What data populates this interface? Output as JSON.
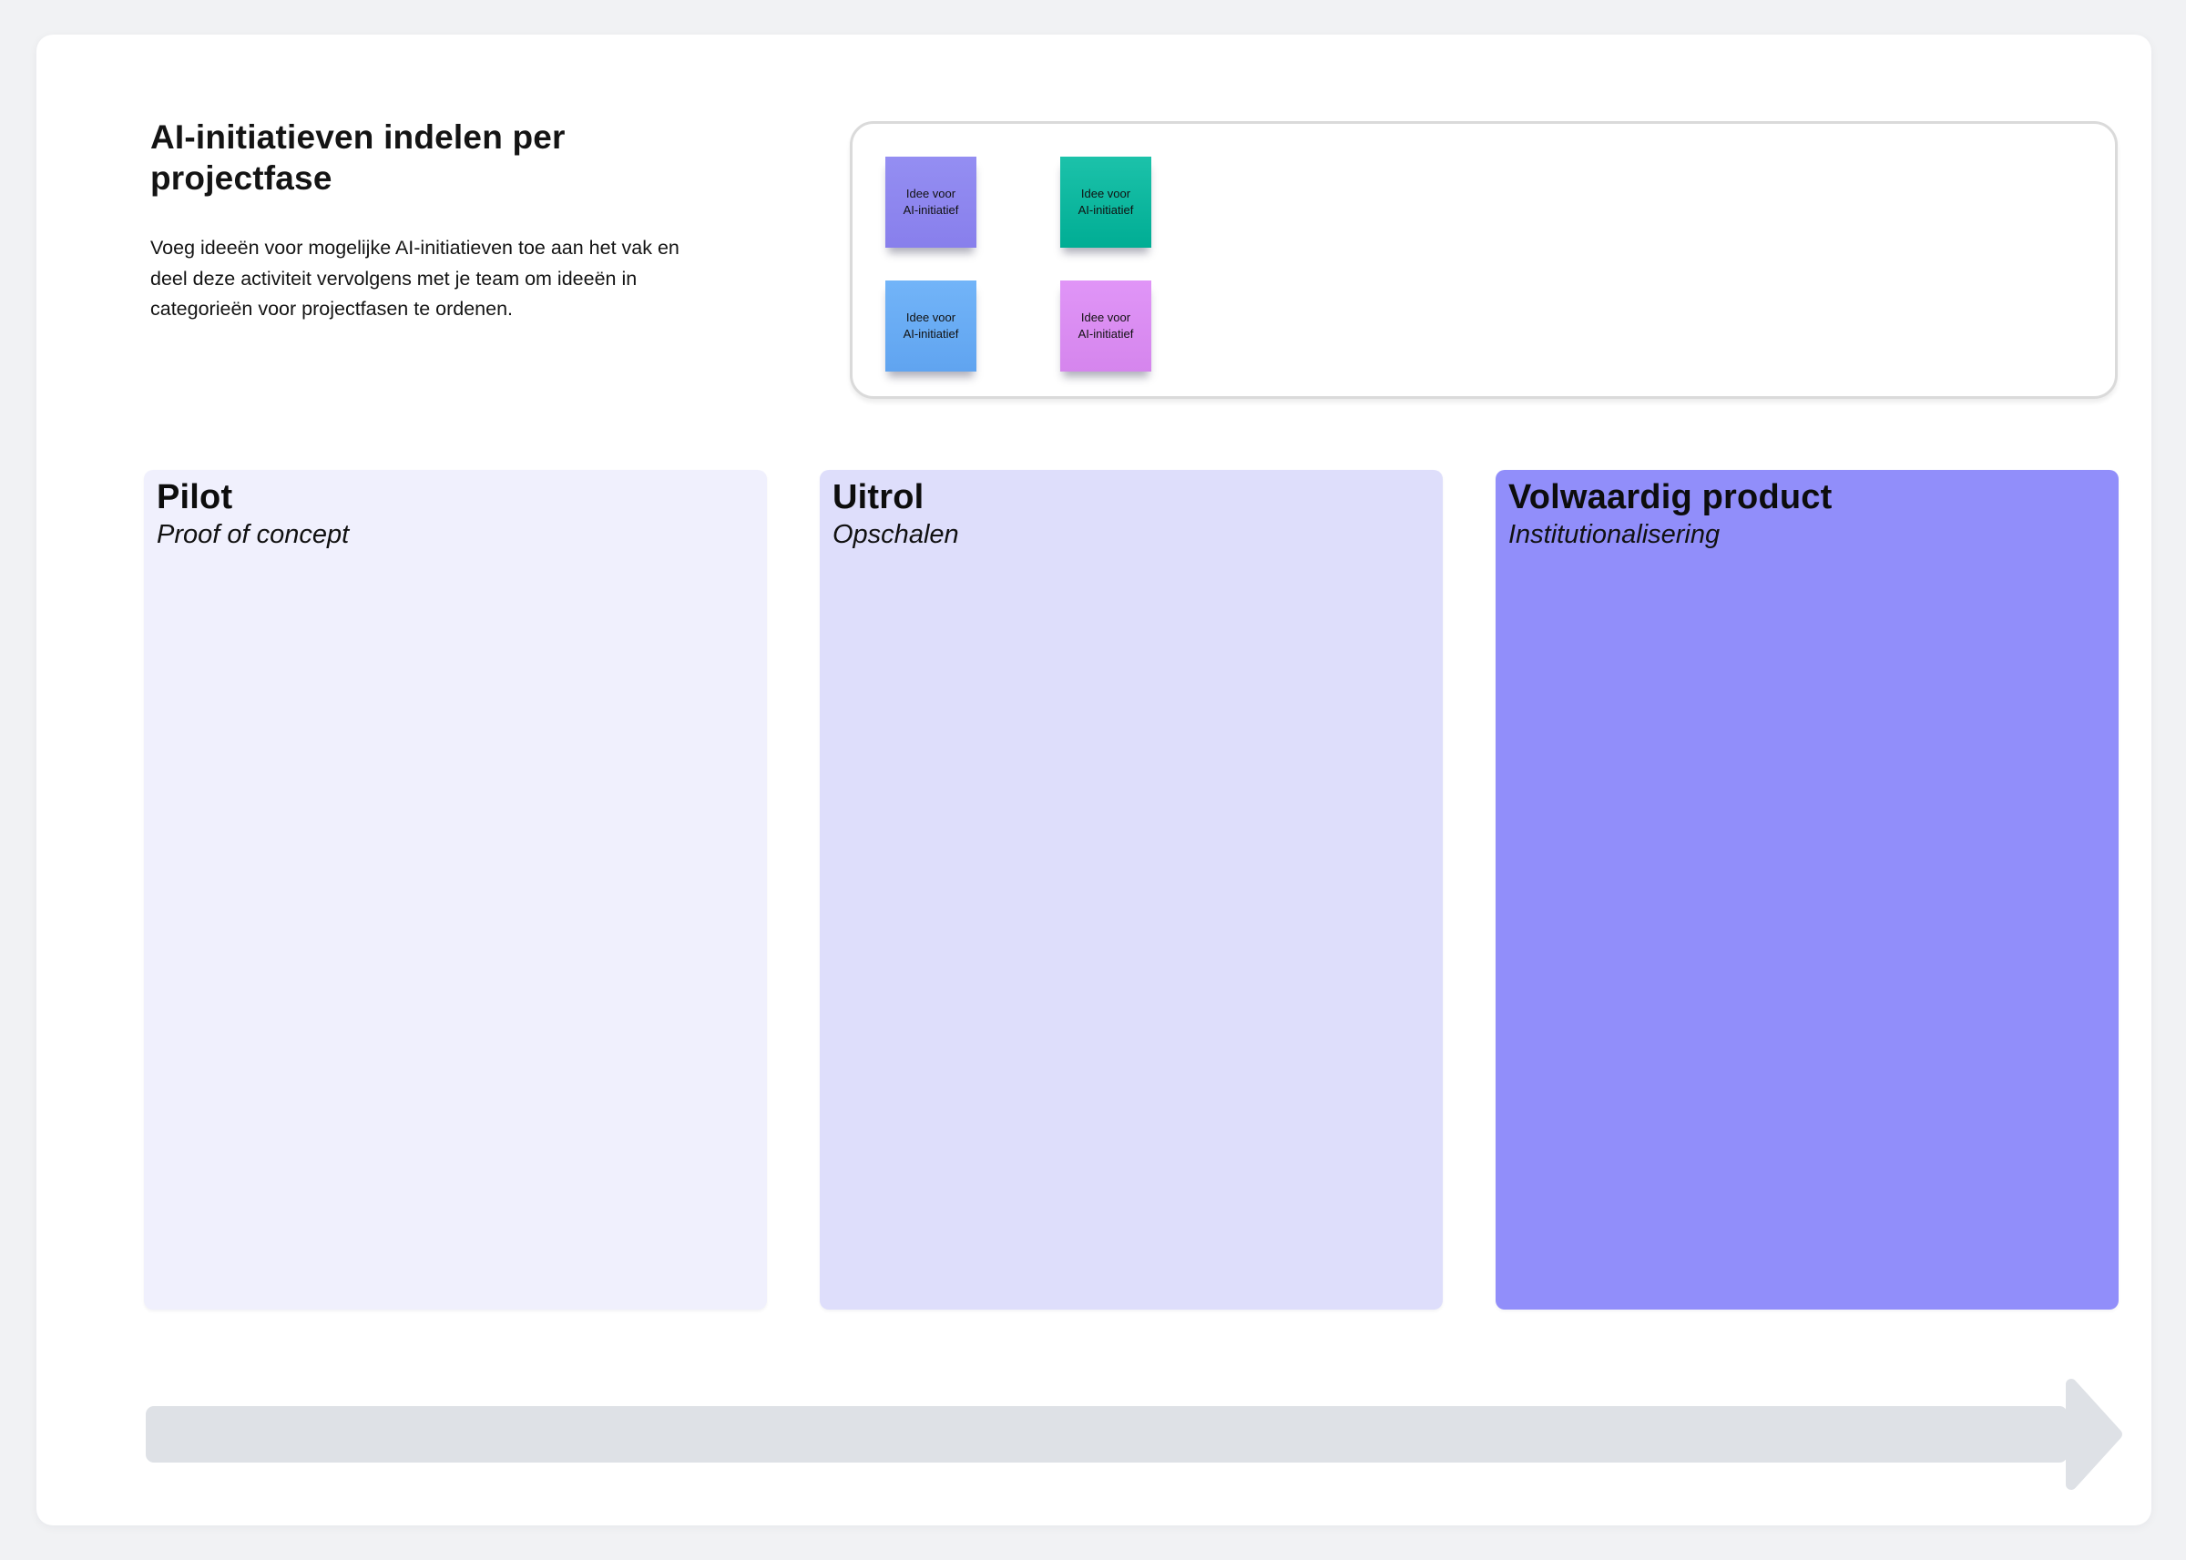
{
  "page": {
    "background_color": "#f1f2f4",
    "card_color": "#ffffff"
  },
  "header": {
    "title": "AI-initiatieven indelen per projectfase",
    "description": "Voeg ideeën voor mogelijke AI-initiatieven toe aan het vak en deel deze activiteit vervolgens met je team om ideeën in categorieën voor projectfasen te ordenen."
  },
  "idea_tray": {
    "border_color": "#dadada",
    "stickies": [
      {
        "label": "Idee voor\nAI-initiatief",
        "color": "#8e88ef",
        "color_name": "purple"
      },
      {
        "label": "Idee voor\nAI-initiatief",
        "color": "#00b79e",
        "color_name": "teal"
      },
      {
        "label": "Idee voor\nAI-initiatief",
        "color": "#69acf4",
        "color_name": "blue"
      },
      {
        "label": "Idee voor\nAI-initiatief",
        "color": "#db8ef2",
        "color_name": "violet"
      }
    ]
  },
  "columns": [
    {
      "title": "Pilot",
      "subtitle": "Proof of concept",
      "color": "#f0f0fd"
    },
    {
      "title": "Uitrol",
      "subtitle": "Opschalen",
      "color": "#dedefb"
    },
    {
      "title": "Volwaardig product",
      "subtitle": "Institutionalisering",
      "color": "#918efa"
    }
  ],
  "timeline_arrow": {
    "color": "#dee1e6",
    "direction": "right"
  }
}
